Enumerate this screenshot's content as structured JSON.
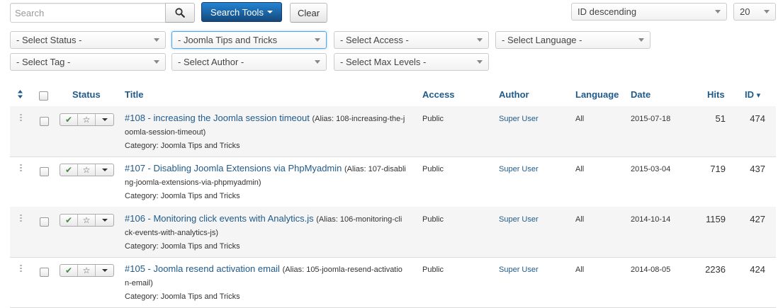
{
  "search": {
    "placeholder": "Search",
    "tools_label": "Search Tools",
    "clear_label": "Clear"
  },
  "ordering": {
    "selected": "ID descending"
  },
  "limit": {
    "selected": "20"
  },
  "filters": {
    "status": "- Select Status -",
    "category": "- Joomla Tips and Tricks",
    "access": "- Select Access -",
    "language": "- Select Language -",
    "tag": "- Select Tag -",
    "author": "- Select Author -",
    "max_levels": "- Select Max Levels -"
  },
  "table": {
    "headers": {
      "status": "Status",
      "title": "Title",
      "access": "Access",
      "author": "Author",
      "language": "Language",
      "date": "Date",
      "hits": "Hits",
      "id": "ID"
    },
    "rows": [
      {
        "title": "#108 - increasing the Joomla session timeout",
        "alias_line1": "(Alias: 108-increasing-the-j",
        "alias_line2": "oomla-session-timeout)",
        "category": "Category: Joomla Tips and Tricks",
        "access": "Public",
        "author": "Super User",
        "language": "All",
        "date": "2015-07-18",
        "hits": "51",
        "id": "474"
      },
      {
        "title": "#107 - Disabling Joomla Extensions via PhpMyadmin",
        "alias_line1": "(Alias: 107-disabli",
        "alias_line2": "ng-joomla-extensions-via-phpmyadmin)",
        "category": "Category: Joomla Tips and Tricks",
        "access": "Public",
        "author": "Super User",
        "language": "All",
        "date": "2015-03-04",
        "hits": "719",
        "id": "437"
      },
      {
        "title": "#106 - Monitoring click events with Analytics.js",
        "alias_line1": "(Alias: 106-monitoring-cli",
        "alias_line2": "ck-events-with-analytics-js)",
        "category": "Category: Joomla Tips and Tricks",
        "access": "Public",
        "author": "Super User",
        "language": "All",
        "date": "2014-10-14",
        "hits": "1159",
        "id": "427"
      },
      {
        "title": "#105 - Joomla resend activation email",
        "alias_line1": "(Alias: 105-joomla-resend-activatio",
        "alias_line2": "n-email)",
        "category": "Category: Joomla Tips and Tricks",
        "access": "Public",
        "author": "Super User",
        "language": "All",
        "date": "2014-08-05",
        "hits": "2236",
        "id": "424"
      }
    ]
  },
  "icons": {
    "search": "search-icon",
    "published": "check-icon",
    "featured": "star-icon",
    "drag": "drag-handle-icon",
    "sort": "sort-icon"
  }
}
